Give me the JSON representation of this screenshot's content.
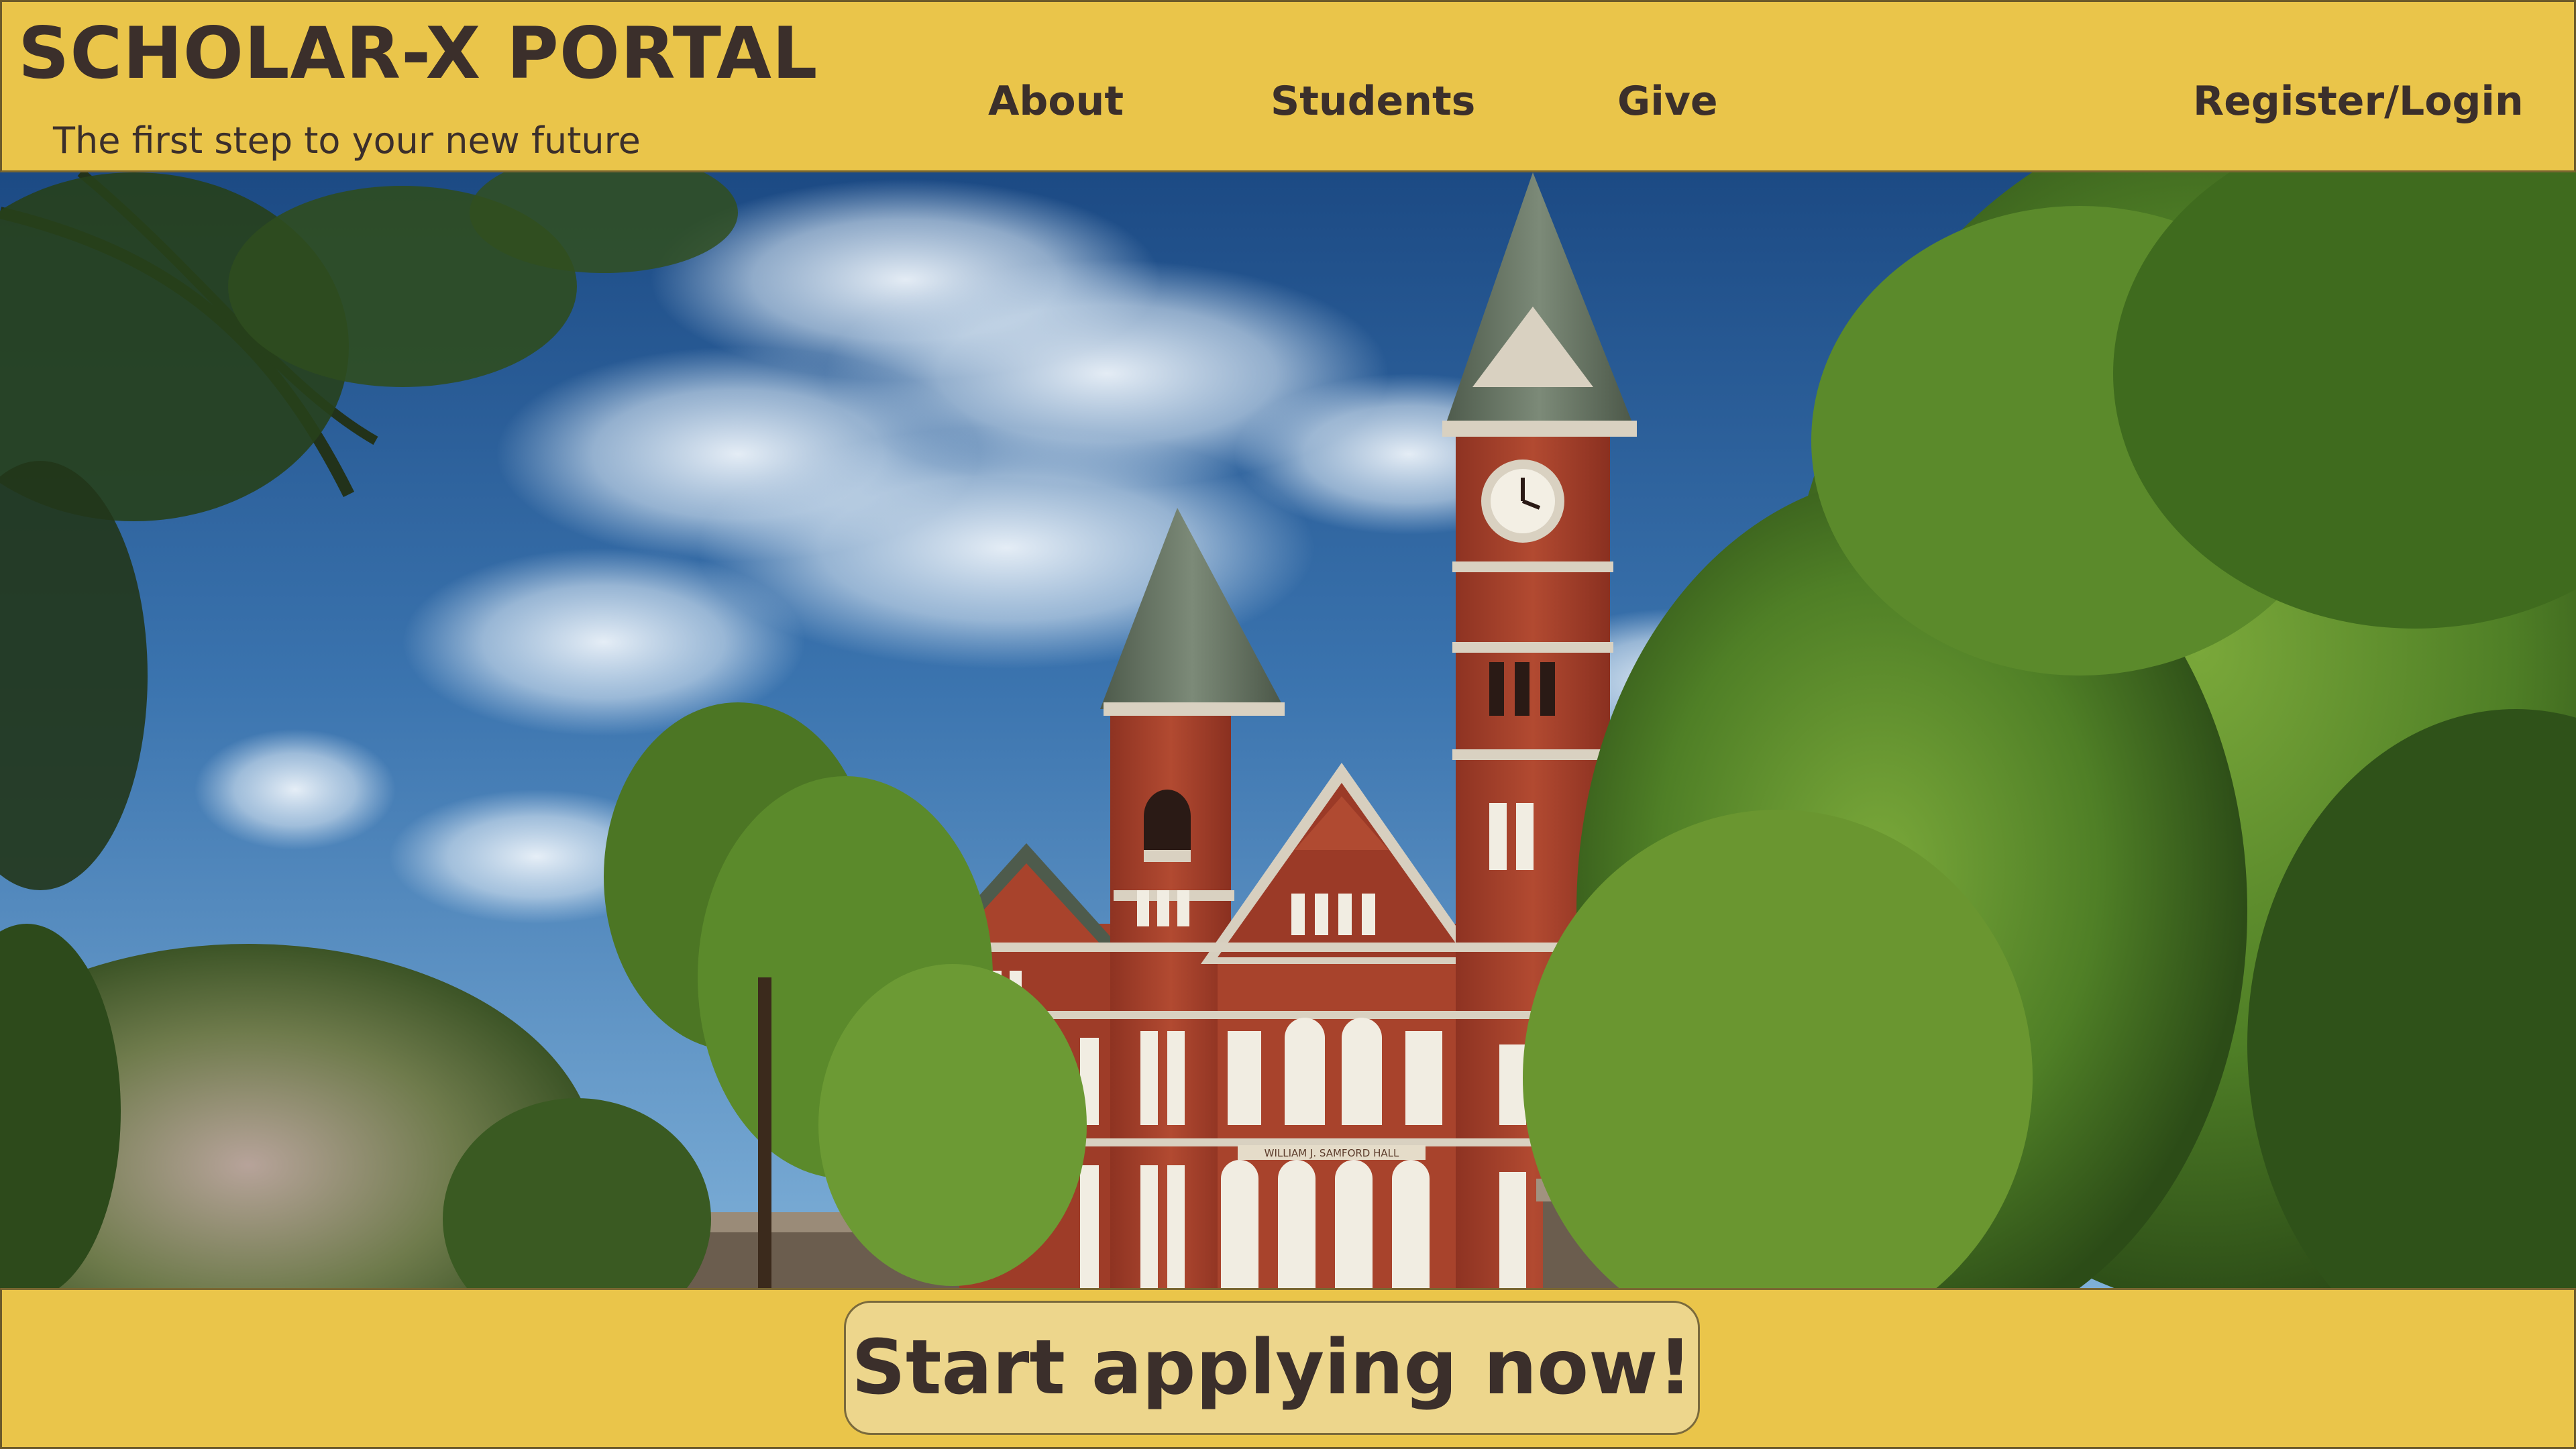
{
  "header": {
    "brand_title": "SCHOLAR-X PORTAL",
    "tagline": "The first step to your new future",
    "nav": {
      "about": "About",
      "students": "Students",
      "give": "Give",
      "register_login": "Register/Login"
    }
  },
  "hero": {
    "image": "campus-clock-tower-photo",
    "sign_text": "WILLIAM J. SAMFORD HALL"
  },
  "cta": {
    "label": "Start applying now!"
  },
  "colors": {
    "brand_gold": "#eac54a",
    "button_fill": "#edd68c",
    "text_dark": "#3b2f2b"
  }
}
